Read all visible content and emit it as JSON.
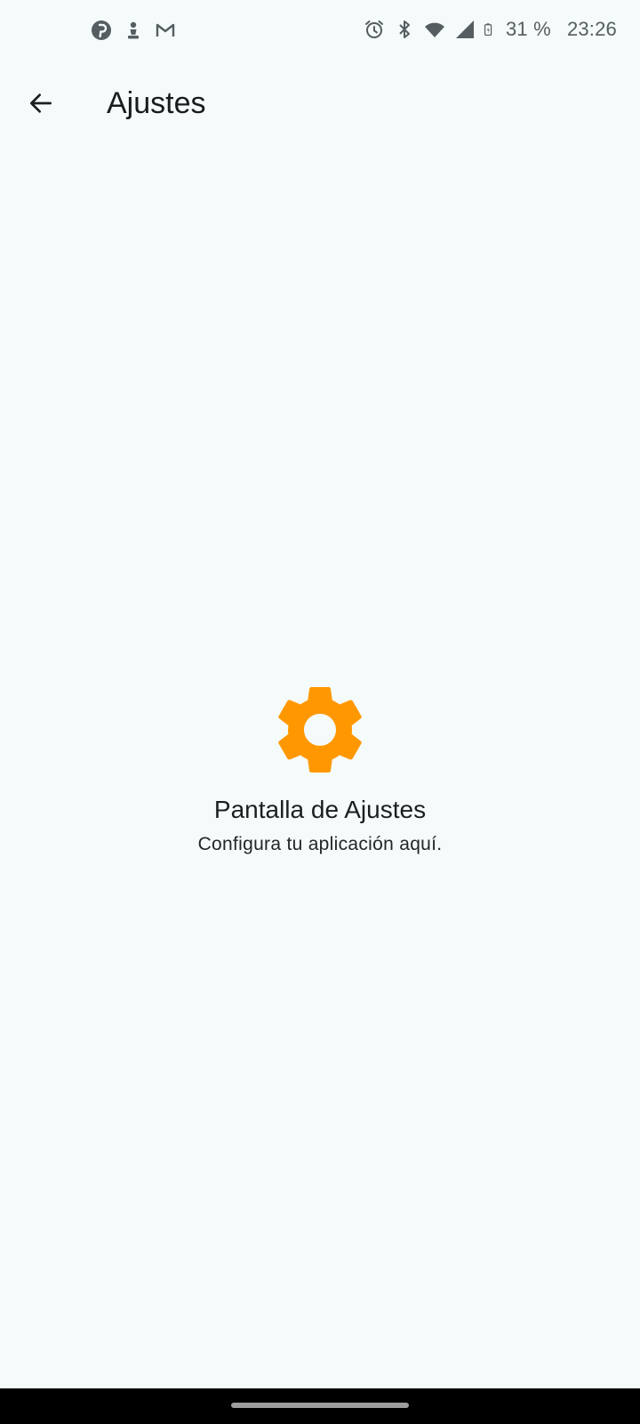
{
  "status_bar": {
    "battery": "31 %",
    "time": "23:26",
    "left_icons": [
      "pinterest-icon",
      "chess-pawn-icon",
      "gmail-icon"
    ],
    "right_icons": [
      "alarm-icon",
      "bluetooth-icon",
      "wifi-icon",
      "signal-icon",
      "battery-charging-icon"
    ]
  },
  "app_bar": {
    "title": "Ajustes",
    "back_icon": "arrow-back-icon"
  },
  "content": {
    "icon": "settings-gear-icon",
    "heading": "Pantalla de Ajustes",
    "subheading": "Configura tu aplicación aquí."
  },
  "colors": {
    "background": "#f5fafa",
    "accent": "#ff9800",
    "text_primary": "#171c1f",
    "status_text": "#555d60",
    "nav_bar": "#000000"
  }
}
